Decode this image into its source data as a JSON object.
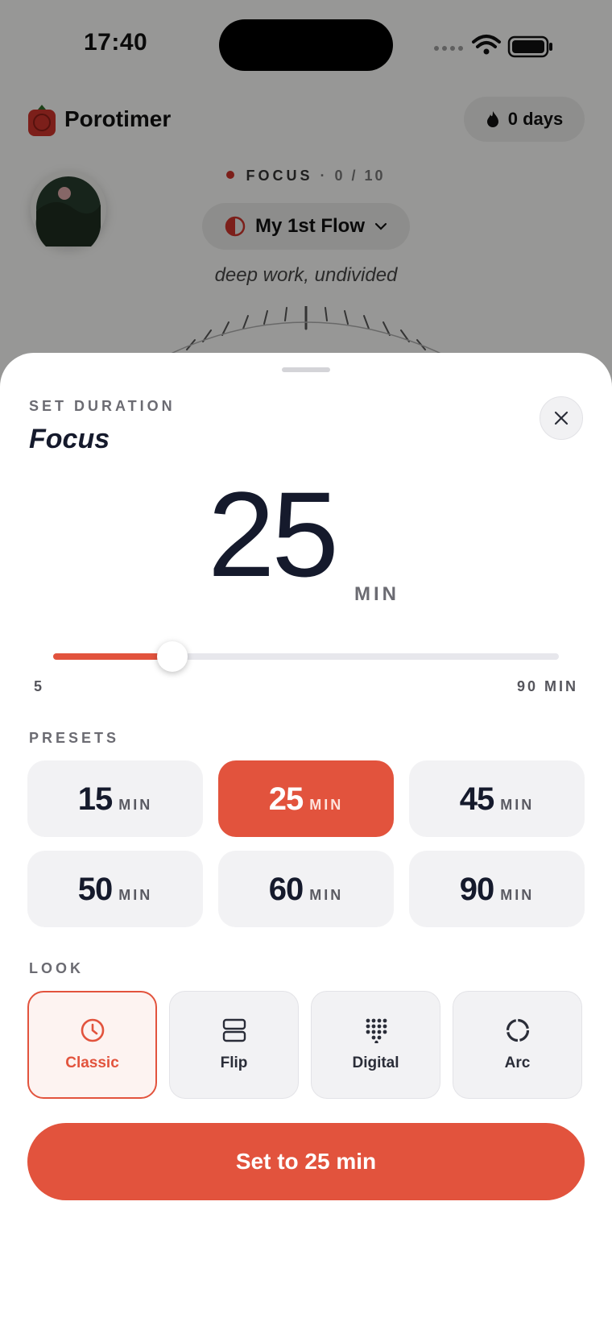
{
  "status_bar": {
    "time": "17:40"
  },
  "app": {
    "name": "Porotimer",
    "streak": "0 days",
    "mode": {
      "label": "FOCUS",
      "separator": "·",
      "count": "0 / 10"
    },
    "flow": {
      "label": "My 1st Flow"
    },
    "tagline": "deep work, undivided"
  },
  "sheet": {
    "overline": "SET DURATION",
    "title": "Focus",
    "value": "25",
    "unit": "MIN",
    "slider": {
      "min_label": "5",
      "max_label": "90 MIN",
      "min": 5,
      "max": 90,
      "value": 25
    },
    "presets_label": "PRESETS",
    "presets": [
      {
        "value": "15",
        "unit": "MIN",
        "selected": false
      },
      {
        "value": "25",
        "unit": "MIN",
        "selected": true
      },
      {
        "value": "45",
        "unit": "MIN",
        "selected": false
      },
      {
        "value": "50",
        "unit": "MIN",
        "selected": false
      },
      {
        "value": "60",
        "unit": "MIN",
        "selected": false
      },
      {
        "value": "90",
        "unit": "MIN",
        "selected": false
      }
    ],
    "look_label": "LOOK",
    "looks": [
      {
        "label": "Classic",
        "icon": "clock-icon",
        "selected": true
      },
      {
        "label": "Flip",
        "icon": "flip-icon",
        "selected": false
      },
      {
        "label": "Digital",
        "icon": "digital-dots-icon",
        "selected": false
      },
      {
        "label": "Arc",
        "icon": "arc-icon",
        "selected": false
      }
    ],
    "cta_label": "Set to 25 min"
  },
  "colors": {
    "accent": "#e2533d",
    "ink": "#151a2c",
    "muted": "#6b6b72"
  }
}
